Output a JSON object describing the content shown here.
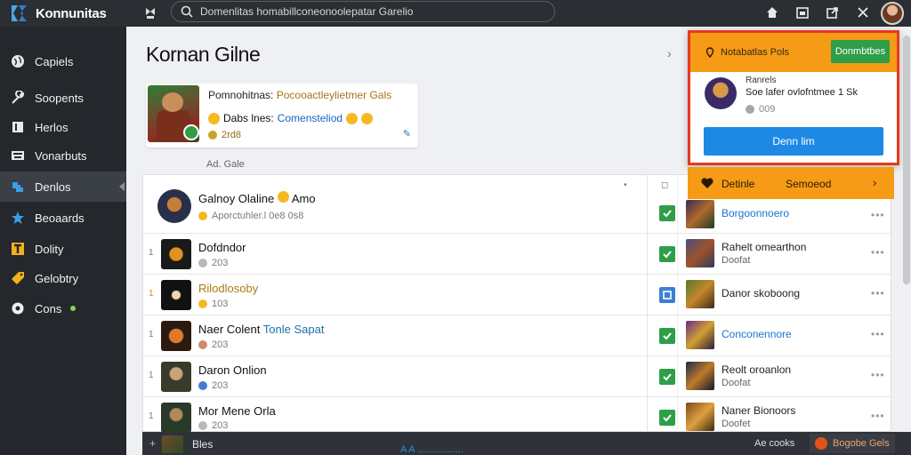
{
  "app": {
    "brand": "Konnunitas"
  },
  "search": {
    "placeholder": "Domenlitas homabillconeonoolepatar Garelio"
  },
  "sidebar": {
    "items": [
      {
        "label": "Capiels",
        "icon": "globe-icon"
      },
      {
        "label": "Soopents",
        "icon": "wrench-icon"
      },
      {
        "label": "Herlos",
        "icon": "book-icon"
      },
      {
        "label": "Vonarbuts",
        "icon": "keyboard-icon"
      },
      {
        "label": "Denlos",
        "icon": "puzzle-icon",
        "active": true
      },
      {
        "label": "Beoaards",
        "icon": "star-icon"
      },
      {
        "label": "Dolity",
        "icon": "t-icon"
      },
      {
        "label": "Gelobtry",
        "icon": "tag-icon"
      },
      {
        "label": "Cons",
        "icon": "circle-icon"
      }
    ]
  },
  "page": {
    "title": "Kornan Gilne"
  },
  "featured": {
    "line1_a": "Pomnohitnas:",
    "line1_b": "Pocooactleylietmer Gals",
    "line2_a": "Dabs lnes:",
    "line2_b": "Comensteliod",
    "line3": "2rd8"
  },
  "section": {
    "label": "Ad. Gale"
  },
  "table": {
    "rows": [
      {
        "name": "Galnoy Olaline",
        "name_suffix": "Amo",
        "sub": "Aporctuhler.l 0e8 0s8",
        "mark": "",
        "check": "green",
        "game_title": "Borgoonnoero",
        "game_sub": "",
        "game_title_color": "blue"
      },
      {
        "name": "Dofdndor",
        "sub": "203",
        "mark": "1",
        "check": "green",
        "game_title": "Rahelt omearthon",
        "game_sub": "Doofat",
        "game_title_color": "dark"
      },
      {
        "name": "Rilodlosoby",
        "sub": "103",
        "mark": "1",
        "check": "blue",
        "game_title": "Danor skoboong",
        "game_sub": "",
        "game_title_color": "dark",
        "name_gold": true
      },
      {
        "name": "Naer Colent",
        "name_link": "Tonle Sapat",
        "sub": "203",
        "mark": "1",
        "check": "green",
        "game_title": "Conconennore",
        "game_sub": "",
        "game_title_color": "blue"
      },
      {
        "name": "Daron Onlion",
        "sub": "203",
        "mark": "1",
        "check": "green",
        "game_title": "Reolt oroanlon",
        "game_sub": "Doofat",
        "game_title_color": "dark"
      },
      {
        "name": "Mor Mene Orla",
        "sub": "203",
        "mark": "1",
        "check": "green",
        "game_title": "Naner Bionoors",
        "game_sub": "Doofet",
        "game_title_color": "dark"
      }
    ]
  },
  "footer": {
    "label": "Bles",
    "link": "A A .................",
    "text": "Ae cooks",
    "button": "Bogobe Gels"
  },
  "popup": {
    "header_text": "Notabatlas Pols",
    "header_button": "Donmbtbes",
    "user_name": "Ranrels",
    "user_desc": "Soe lafer ovlofntmee 1 Sk",
    "user_stat": "009",
    "main_button": "Denn lim"
  },
  "popup_bar": {
    "label_a": "Detinle",
    "label_b": "Semoeod"
  },
  "colors": {
    "accent": "#f59b15",
    "popup_border": "#e53a1e",
    "primary_btn": "#1e88e5",
    "success": "#2e9e48"
  }
}
